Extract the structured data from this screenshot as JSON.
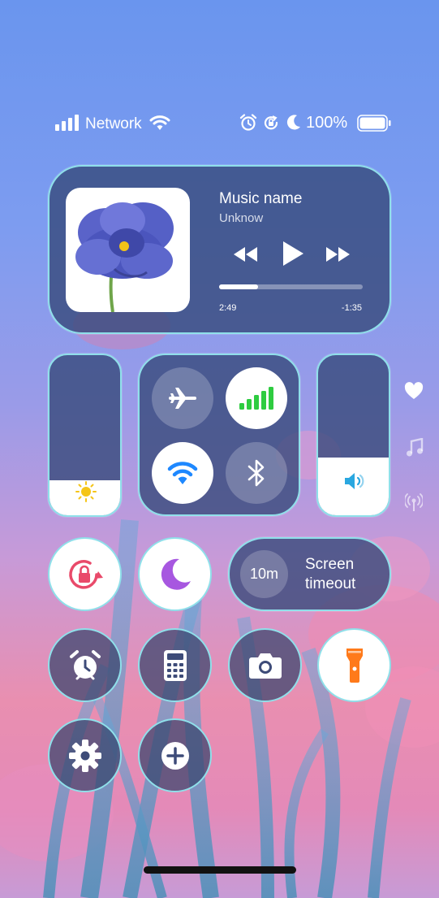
{
  "status_bar": {
    "network_label": "Network",
    "battery_text": "100%"
  },
  "music": {
    "title": "Music name",
    "artist": "Unknow",
    "elapsed": "2:49",
    "remaining": "-1:35",
    "progress": 0.27
  },
  "brightness": {
    "level": 0.22
  },
  "volume": {
    "level": 0.36
  },
  "screen_timeout": {
    "value": "10m",
    "label_line1": "Screen",
    "label_line2": "timeout"
  },
  "colors": {
    "panel_border": "#8fe0ea",
    "signal_green": "#2ecc40",
    "wifi_blue": "#1e88ff",
    "sun_yellow": "#f5c518",
    "volume_blue": "#2aa7e0",
    "rotation_lock_red": "#e94a6a",
    "moon_purple": "#a757e0",
    "flashlight_orange": "#ff7a1a"
  }
}
